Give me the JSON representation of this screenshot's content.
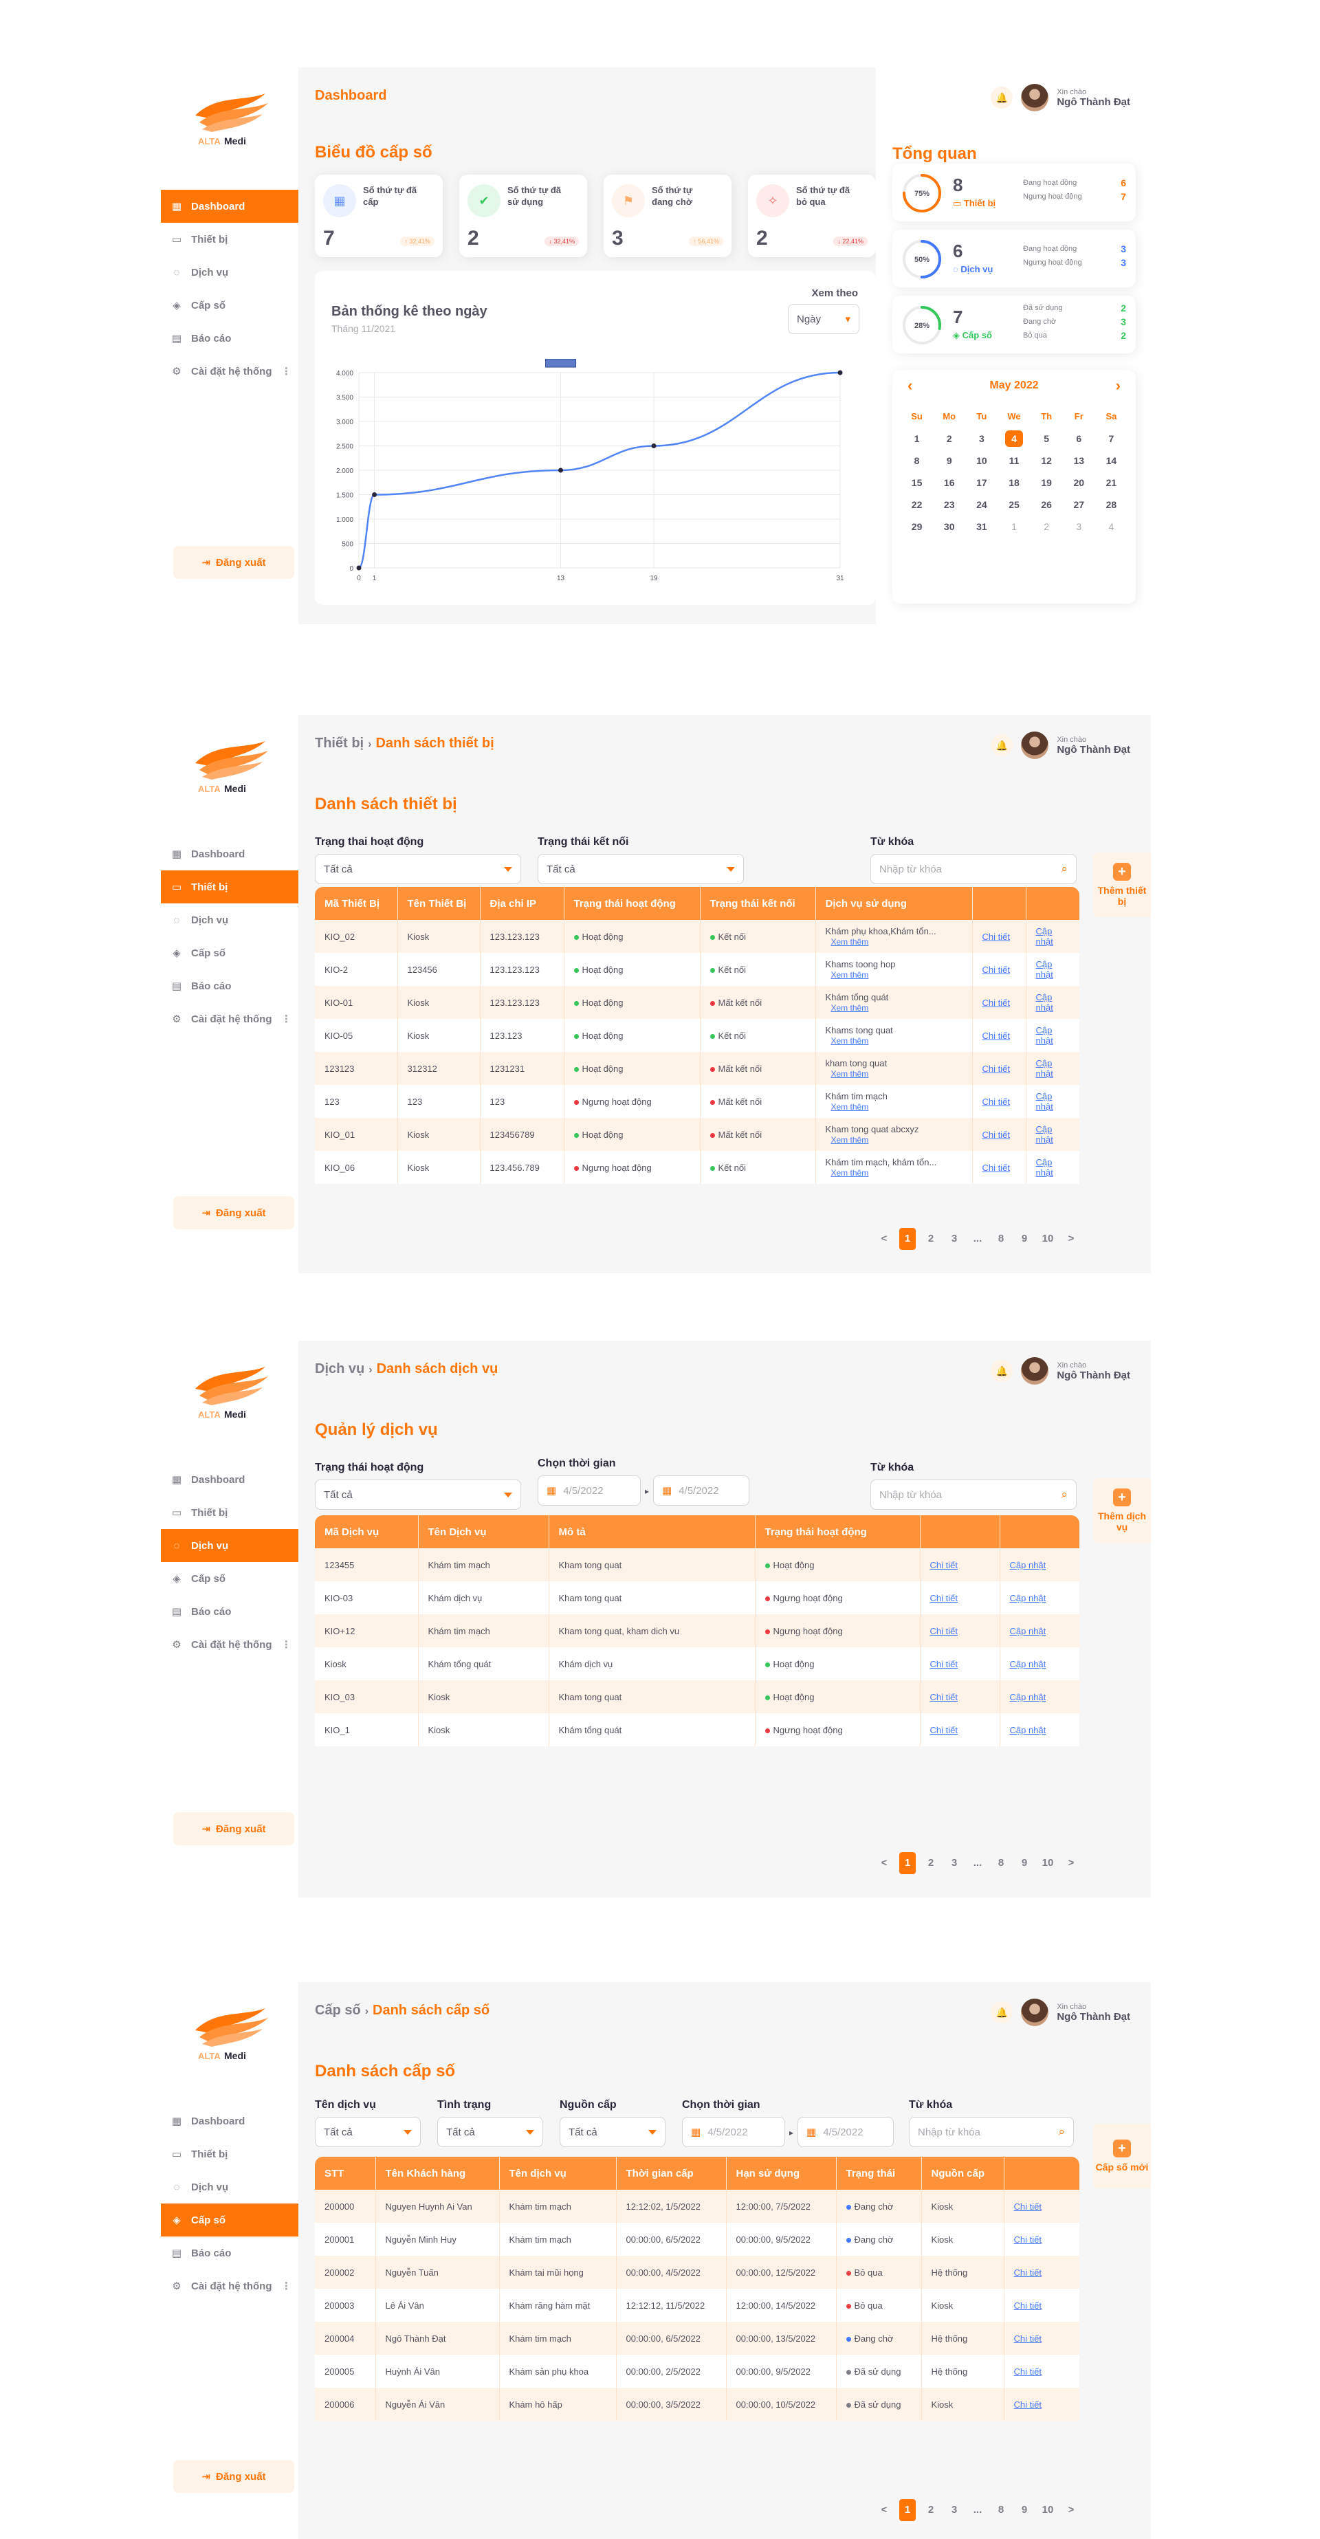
{
  "user": {
    "hello": "Xin chào",
    "name": "Ngô Thành Đạt"
  },
  "menu": [
    {
      "key": "dashboard",
      "label": "Dashboard",
      "icon": "dashboard-icon"
    },
    {
      "key": "device",
      "label": "Thiết bị",
      "icon": "monitor-icon"
    },
    {
      "key": "service",
      "label": "Dịch vụ",
      "icon": "chat-icon"
    },
    {
      "key": "number",
      "label": "Cấp số",
      "icon": "layers-icon"
    },
    {
      "key": "report",
      "label": "Báo cáo",
      "icon": "report-icon"
    },
    {
      "key": "settings",
      "label": "Cài đặt hệ thống",
      "icon": "gear-icon"
    }
  ],
  "logout": "Đăng xuất",
  "logo_text": "Medi",
  "dashboard": {
    "breadcrumb": "Dashboard",
    "title": "Biểu đồ cấp số",
    "cards": [
      {
        "label": "Số thứ tự đã cấp",
        "value": "7",
        "badge": "↑ 32,41%",
        "color": "#6695fb"
      },
      {
        "label": "Số thứ tự đã sử dụng",
        "value": "2",
        "badge": "↓ 32,41%",
        "color": "#35c75a"
      },
      {
        "label": "Số thứ tự đang chờ",
        "value": "3",
        "badge": "↑ 56,41%",
        "color": "#ffac6a"
      },
      {
        "label": "Số thứ tự đã bỏ qua",
        "value": "2",
        "badge": "↓ 22,41%",
        "color": "#f86d6d"
      }
    ],
    "chart_card": {
      "title": "Bản thống kê theo ngày",
      "subtitle": "Tháng 11/2021",
      "view_label": "Xem theo",
      "view_value": "Ngày"
    },
    "overview": {
      "title": "Tổng quan",
      "items": [
        {
          "pct": "75%",
          "value": "8",
          "kind": "Thiết bị",
          "color": "#ff7506",
          "rows": [
            {
              "label": "Đang hoạt động",
              "value": "6"
            },
            {
              "label": "Ngưng hoạt động",
              "value": "7"
            }
          ]
        },
        {
          "pct": "50%",
          "value": "6",
          "kind": "Dịch vụ",
          "color": "#4277ff",
          "rows": [
            {
              "label": "Đang hoạt động",
              "value": "3"
            },
            {
              "label": "Ngưng hoạt động",
              "value": "3"
            }
          ]
        },
        {
          "pct": "28%",
          "value": "7",
          "kind": "Cấp số",
          "color": "#35c75a",
          "rows": [
            {
              "label": "Đã sử dụng",
              "value": "2"
            },
            {
              "label": "Đang chờ",
              "value": "3"
            },
            {
              "label": "Bỏ qua",
              "value": "2"
            }
          ]
        }
      ],
      "pct_values": [
        0.75,
        0.5,
        0.28
      ]
    },
    "calendar": {
      "month": "May 2022",
      "day_names": [
        "Su",
        "Mo",
        "Tu",
        "We",
        "Th",
        "Fr",
        "Sa"
      ],
      "days": [
        "1",
        "2",
        "3",
        "4",
        "5",
        "6",
        "7",
        "8",
        "9",
        "10",
        "11",
        "12",
        "13",
        "14",
        "15",
        "16",
        "17",
        "18",
        "19",
        "20",
        "21",
        "22",
        "23",
        "24",
        "25",
        "26",
        "27",
        "28",
        "29",
        "30",
        "31",
        "1",
        "2",
        "3",
        "4"
      ],
      "selected": "4"
    }
  },
  "chart_data": {
    "type": "line",
    "title": "Bản thống kê theo ngày",
    "subtitle": "Tháng 11/2021",
    "x": [
      "0",
      "1",
      "13",
      "19",
      "31"
    ],
    "series": [
      {
        "values": [
          0,
          1500,
          2000,
          2500,
          4000
        ]
      }
    ],
    "y_ticks": [
      "0",
      "500",
      "1.000",
      "1.500",
      "2.000",
      "2.500",
      "3.000",
      "3.500",
      "4.000"
    ],
    "ylim": [
      0,
      4000
    ],
    "grid": true,
    "color": "#5185f7"
  },
  "devices": {
    "breadcrumb_parent": "Thiết bị",
    "breadcrumb_current": "Danh sách thiết bị",
    "title": "Danh sách thiết bị",
    "filter_status_label": "Trạng thai hoạt động",
    "filter_status_value": "Tất cả",
    "filter_conn_label": "Trạng thái kết nối",
    "filter_conn_value": "Tất cả",
    "keyword_label": "Từ khóa",
    "keyword_placeholder": "Nhập từ khóa",
    "add_label": "Thêm thiết bị",
    "columns": [
      "Mã Thiết Bị",
      "Tên Thiết Bị",
      "Địa chỉ IP",
      "Trạng thái hoạt động",
      "Trạng thái kết nối",
      "Dịch vụ sử dụng",
      "",
      ""
    ],
    "more_label": "Xem thêm",
    "detail_label": "Chi tiết",
    "update_label": "Cập nhật",
    "rows": [
      {
        "id": "KIO_02",
        "name": "Kiosk",
        "ip": "123.123.123",
        "status": "Hoạt động",
        "s_ok": true,
        "conn": "Kết nối",
        "c_ok": true,
        "svc": "Khám phụ khoa,Khám tổn..."
      },
      {
        "id": "KIO-2",
        "name": "123456",
        "ip": "123.123.123",
        "status": "Hoạt động",
        "s_ok": true,
        "conn": "Kết nối",
        "c_ok": true,
        "svc": "Khams toong hop"
      },
      {
        "id": "KIO-01",
        "name": "Kiosk",
        "ip": "123.123.123",
        "status": "Hoạt động",
        "s_ok": true,
        "conn": "Mất kết nối",
        "c_ok": false,
        "svc": "Khám tổng quát"
      },
      {
        "id": "KIO-05",
        "name": "Kiosk",
        "ip": "123.123",
        "status": "Hoạt động",
        "s_ok": true,
        "conn": "Kết nối",
        "c_ok": true,
        "svc": "Khams tong quat"
      },
      {
        "id": "123123",
        "name": "312312",
        "ip": "1231231",
        "status": "Hoạt động",
        "s_ok": true,
        "conn": "Mất kết nối",
        "c_ok": false,
        "svc": "kham tong quat"
      },
      {
        "id": "123",
        "name": "123",
        "ip": "123",
        "status": "Ngưng hoạt động",
        "s_ok": false,
        "conn": "Mất kết nối",
        "c_ok": false,
        "svc": "Khám tim mạch"
      },
      {
        "id": "KIO_01",
        "name": "Kiosk",
        "ip": "123456789",
        "status": "Hoạt động",
        "s_ok": true,
        "conn": "Mất kết nối",
        "c_ok": false,
        "svc": "Kham tong quat abcxyz"
      },
      {
        "id": "KIO_06",
        "name": "Kiosk",
        "ip": "123.456.789",
        "status": "Ngưng hoạt động",
        "s_ok": false,
        "conn": "Kết nối",
        "c_ok": true,
        "svc": "Khám tim mạch, khám tổn..."
      }
    ]
  },
  "services": {
    "breadcrumb_parent": "Dịch vụ",
    "breadcrumb_current": "Danh sách dịch vụ",
    "title": "Quản lý dịch vụ",
    "filter_status_label": "Trạng thái hoạt động",
    "filter_status_value": "Tất cả",
    "time_label": "Chọn thời gian",
    "date_from": "4/5/2022",
    "date_to": "4/5/2022",
    "keyword_label": "Từ khóa",
    "keyword_placeholder": "Nhập từ khóa",
    "add_label": "Thêm dịch vụ",
    "columns": [
      "Mã Dịch vụ",
      "Tên Dịch vụ",
      "Mô tả",
      "Trạng thái hoạt động",
      "",
      ""
    ],
    "detail_label": "Chi tiết",
    "update_label": "Cập nhật",
    "rows": [
      {
        "id": "123455",
        "name": "Khám tim mạch",
        "desc": "Kham tong quat",
        "status": "Hoạt động",
        "ok": true
      },
      {
        "id": "KIO-03",
        "name": "Khám dịch vụ",
        "desc": "Kham tong quat",
        "status": "Ngưng hoạt động",
        "ok": false
      },
      {
        "id": "KIO+12",
        "name": "Khám tim mạch",
        "desc": "Kham tong quat, kham dich vu",
        "status": "Ngưng hoạt động",
        "ok": false
      },
      {
        "id": "Kiosk",
        "name": "Khám tổng quát",
        "desc": "Khám dịch vụ",
        "status": "Hoạt động",
        "ok": true
      },
      {
        "id": "KIO_03",
        "name": "Kiosk",
        "desc": "Kham tong quat",
        "status": "Hoạt động",
        "ok": true
      },
      {
        "id": "KIO_1",
        "name": "Kiosk",
        "desc": "Khám tổng quát",
        "status": "Ngưng hoạt động",
        "ok": false
      }
    ]
  },
  "numbers": {
    "breadcrumb_parent": "Cấp số",
    "breadcrumb_current": "Danh sách cấp số",
    "title": "Danh sách cấp số",
    "f1_label": "Tên dịch vụ",
    "f1_value": "Tất cả",
    "f2_label": "Tình trạng",
    "f2_value": "Tất cả",
    "f3_label": "Nguồn cấp",
    "f3_value": "Tất cả",
    "time_label": "Chọn thời gian",
    "date_from": "4/5/2022",
    "date_to": "4/5/2022",
    "keyword_label": "Từ khóa",
    "keyword_placeholder": "Nhập từ khóa",
    "add_label": "Cấp số mới",
    "columns": [
      "STT",
      "Tên Khách hàng",
      "Tên dịch vụ",
      "Thời gian cấp",
      "Hạn sử dụng",
      "Trạng thái",
      "Nguồn cấp",
      ""
    ],
    "detail_label": "Chi tiết",
    "rows": [
      {
        "stt": "200000",
        "cust": "Nguyen Huynh Ai Van",
        "svc": "Khám tim mạch",
        "t1": "12:12:02, 1/5/2022",
        "t2": "12:00:00, 7/5/2022",
        "status": "Đang chờ",
        "color": "#4277ff",
        "src": "Kiosk"
      },
      {
        "stt": "200001",
        "cust": "Nguyễn Minh Huy",
        "svc": "Khám tim mạch",
        "t1": "00:00:00, 6/5/2022",
        "t2": "00:00:00, 9/5/2022",
        "status": "Đang chờ",
        "color": "#4277ff",
        "src": "Kiosk"
      },
      {
        "stt": "200002",
        "cust": "Nguyễn Tuấn",
        "svc": "Khám tai mũi họng",
        "t1": "00:00:00, 4/5/2022",
        "t2": "00:00:00, 12/5/2022",
        "status": "Bỏ qua",
        "color": "#e73f3f",
        "src": "Hệ thống"
      },
      {
        "stt": "200003",
        "cust": "Lê Ái Vân",
        "svc": "Khám răng hàm mặt",
        "t1": "12:12:12, 11/5/2022",
        "t2": "12:00:00, 14/5/2022",
        "status": "Bỏ qua",
        "color": "#e73f3f",
        "src": "Kiosk"
      },
      {
        "stt": "200004",
        "cust": "Ngô Thành Đạt",
        "svc": "Khám tim mạch",
        "t1": "00:00:00, 6/5/2022",
        "t2": "00:00:00, 13/5/2022",
        "status": "Đang chờ",
        "color": "#4277ff",
        "src": "Hệ thống"
      },
      {
        "stt": "200005",
        "cust": "Huỳnh Ái Vân",
        "svc": "Khám sản phụ khoa",
        "t1": "00:00:00, 2/5/2022",
        "t2": "00:00:00, 9/5/2022",
        "status": "Đã sử dụng",
        "color": "#7e7d88",
        "src": "Hệ thống"
      },
      {
        "stt": "200006",
        "cust": "Nguyễn Ái Vân",
        "svc": "Khám hô hấp",
        "t1": "00:00:00, 3/5/2022",
        "t2": "00:00:00, 10/5/2022",
        "status": "Đã sử dụng",
        "color": "#7e7d88",
        "src": "Kiosk"
      }
    ]
  },
  "pager": [
    "<",
    "1",
    "2",
    "3",
    "...",
    "8",
    "9",
    "10",
    ">"
  ],
  "pager_active": "1"
}
